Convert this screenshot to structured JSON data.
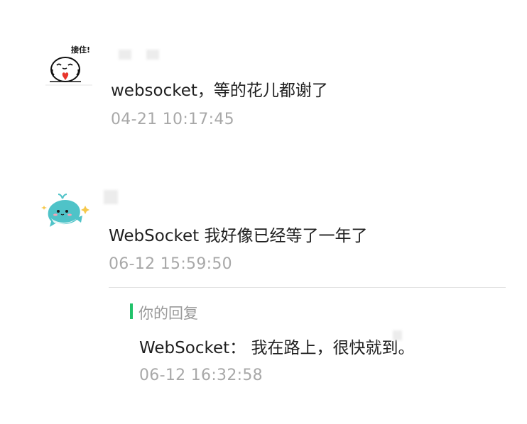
{
  "comments": [
    {
      "avatar_icon": "catch-sticker-avatar",
      "avatar_text": "接住!",
      "text": "websocket，等的花儿都谢了",
      "time": "04-21 10:17:45"
    },
    {
      "avatar_icon": "whale-avatar",
      "text": "WebSocket 我好像已经等了一年了",
      "time": "06-12 15:59:50",
      "reply": {
        "label": "你的回复",
        "text": "WebSocket： 我在路上，很快就到。",
        "time": "06-12 16:32:58"
      }
    }
  ],
  "colors": {
    "reply_bar": "#21c26a",
    "timestamp": "#a8a8a8",
    "text": "#1f1f1f",
    "whale": "#4fc3c8"
  }
}
